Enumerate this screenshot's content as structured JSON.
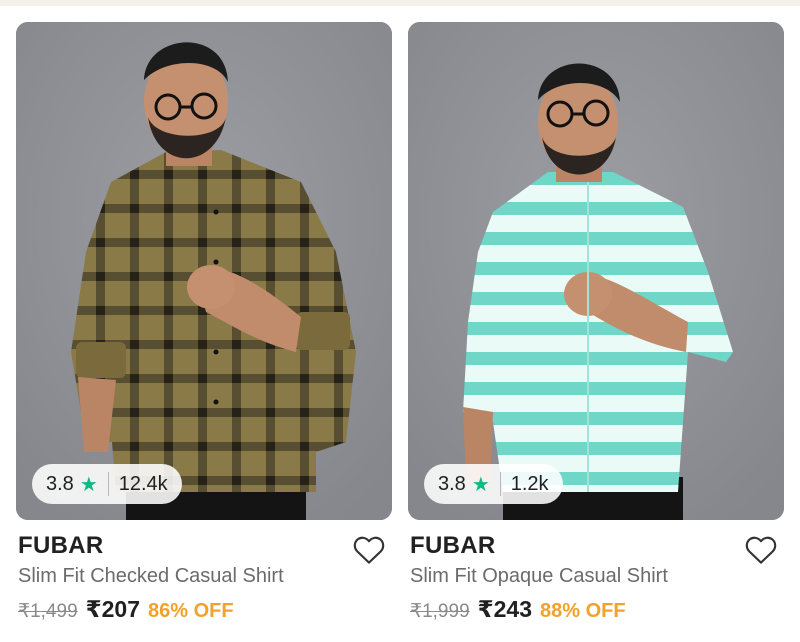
{
  "products": [
    {
      "brand": "FUBAR",
      "title": "Slim Fit Checked Casual Shirt",
      "rating": "3.8",
      "rating_icon": "star-icon",
      "review_count": "12.4k",
      "mrp": "₹1,499",
      "price": "₹207",
      "discount": "86% OFF",
      "shirt_color": "#8a7a48",
      "shirt_pattern_color": "#2f2a1e"
    },
    {
      "brand": "FUBAR",
      "title": "Slim Fit Opaque Casual Shirt",
      "rating": "3.8",
      "rating_icon": "star-icon",
      "review_count": "1.2k",
      "mrp": "₹1,999",
      "price": "₹243",
      "discount": "88% OFF",
      "shirt_color": "#eafaf6",
      "shirt_pattern_color": "#6fd6c8"
    }
  ],
  "colors": {
    "star": "#12b886",
    "discount": "#f2a22b",
    "image_bg": "#8f9196"
  }
}
